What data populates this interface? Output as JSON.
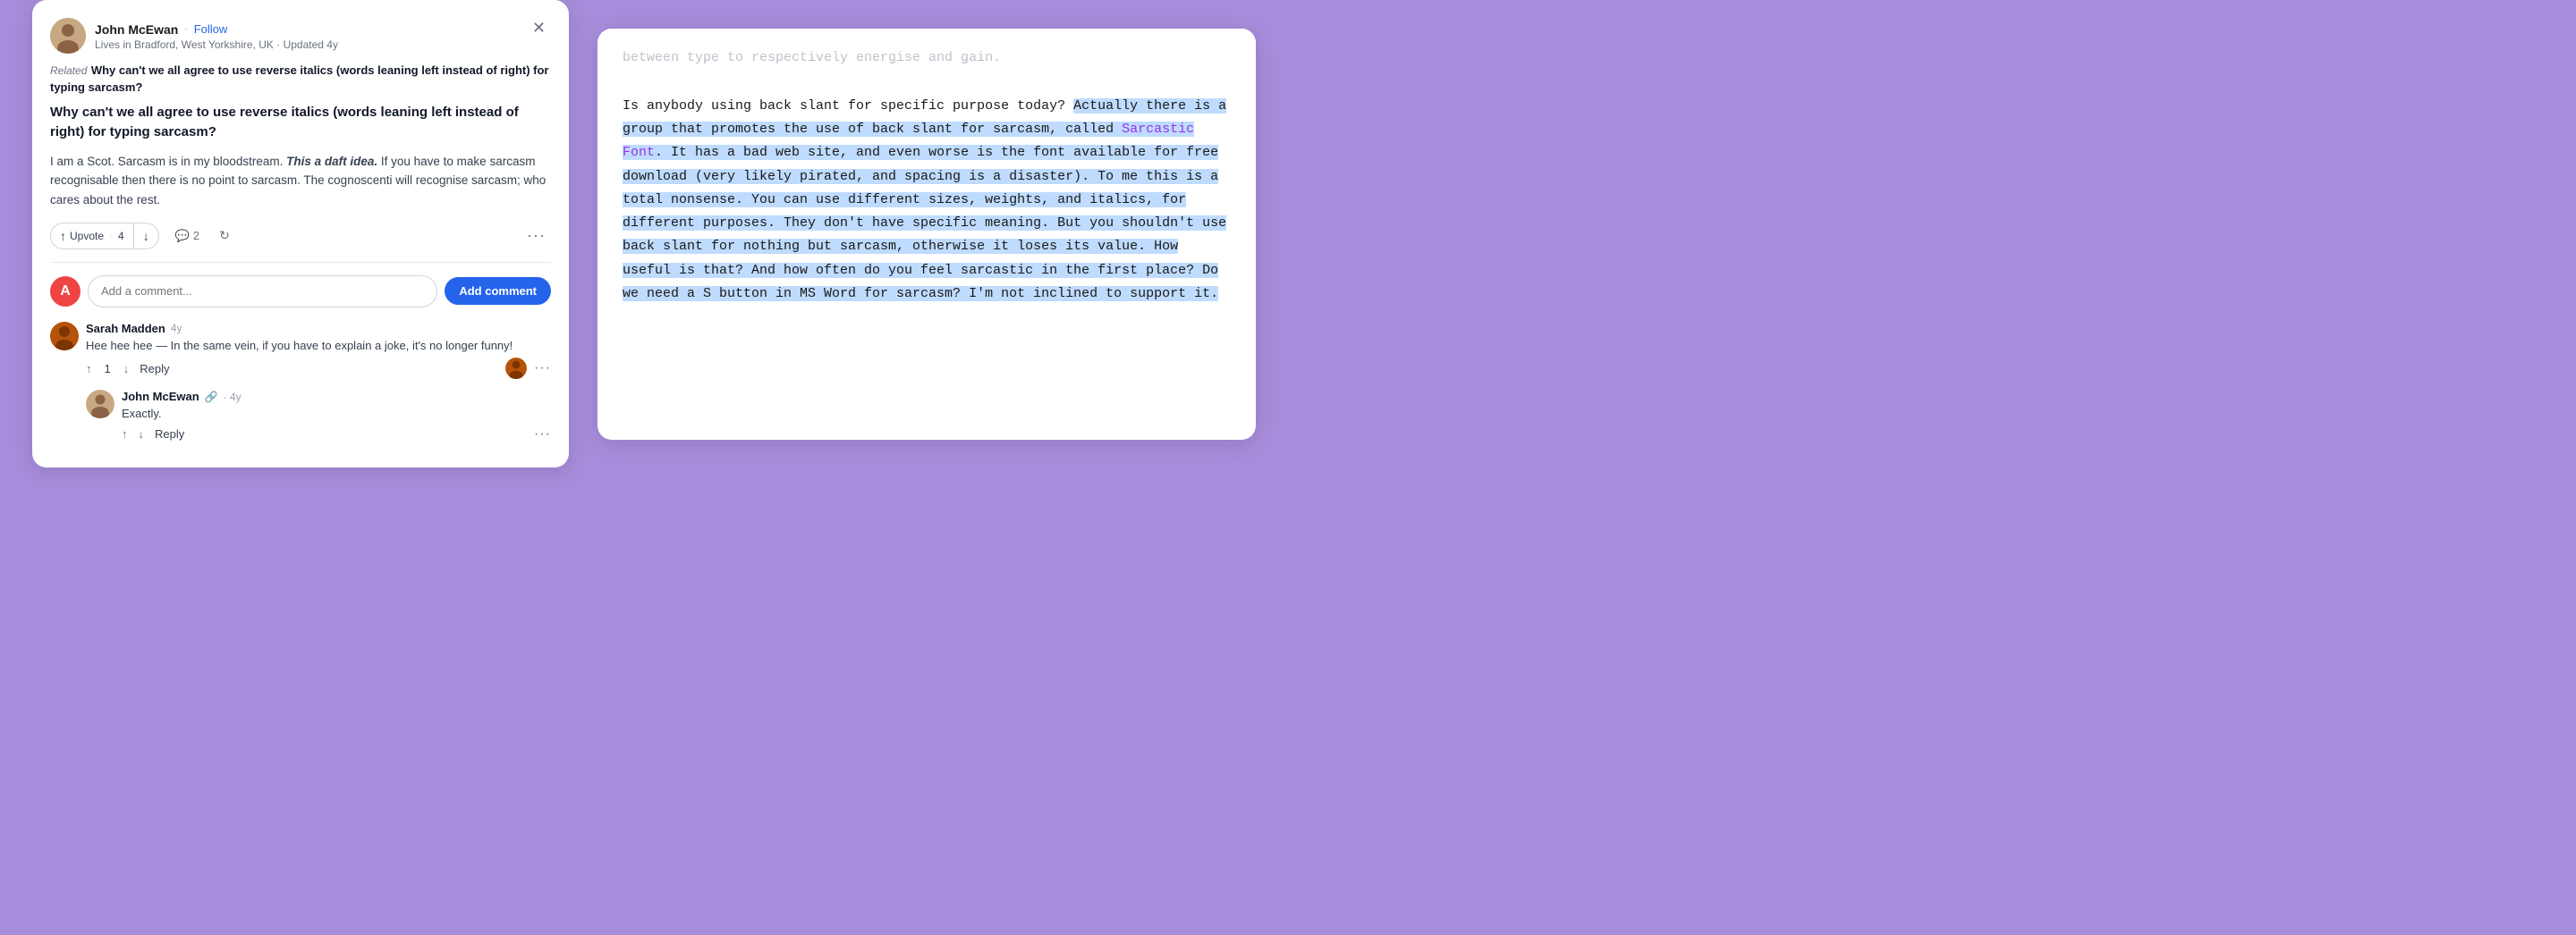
{
  "left_card": {
    "user": {
      "name": "John McEwan",
      "follow": "Follow",
      "location": "Lives in Bradford, West Yorkshire, UK",
      "updated": "Updated 4y"
    },
    "related_label": "Related",
    "question_small": "Why can't we all agree to use reverse italics (words leaning left instead of right) for typing sarcasm?",
    "question_large": "Why can't we all agree to use reverse italics (words leaning left instead of right) for typing sarcasm?",
    "answer": {
      "text_before_bold": "I am a Scot. Sarcasm is in my bloodstream. ",
      "bold_italic": "This a daft idea.",
      "text_after": " If you have to make sarcasm recognisable then there is no point to sarcasm. The cognoscenti will recognise sarcasm; who cares about the rest."
    },
    "vote_label": "Upvote",
    "vote_count": "4",
    "comment_count": "2",
    "comment_placeholder": "Add a comment...",
    "add_comment_label": "Add comment",
    "comments_user_initial": "A",
    "comments": [
      {
        "id": "sarah",
        "author": "Sarah Madden",
        "time": "4y",
        "text": "Hee hee hee — In the same vein, if you have to explain a joke, it's no longer funny!",
        "upvotes": "1",
        "show_reply": true
      },
      {
        "id": "john_nested",
        "author": "John McEwan",
        "icon": "🔗",
        "time": "4y",
        "text": "Exactly.",
        "upvotes": null,
        "show_reply": true,
        "nested": true
      }
    ]
  },
  "right_card": {
    "faded_top": "between type to respectively energise and gain.",
    "main_text_plain": "Is anybody using back slant for specific purpose today? ",
    "highlighted_text": "Actually there is a group that promotes the use of back slant for sarcasm, called ",
    "sarcastic_font_link": "Sarcastic Font",
    "highlighted_text_after": ". It has a bad web site, and even worse is the font available for free download (very likely pirated, and spacing is a disaster). To me this is a total nonsense. You can use different sizes, weights, and italics, for different purposes. They don't have specific meaning. But you shouldn't use back slant for nothing but sarcasm, otherwise it loses its value. How useful is that? And how often do you feel sarcastic in the first place? Do we need a S button in MS Word for sarcasm? I'm not inclined to support it.",
    "highlight_end_marker": "it."
  }
}
